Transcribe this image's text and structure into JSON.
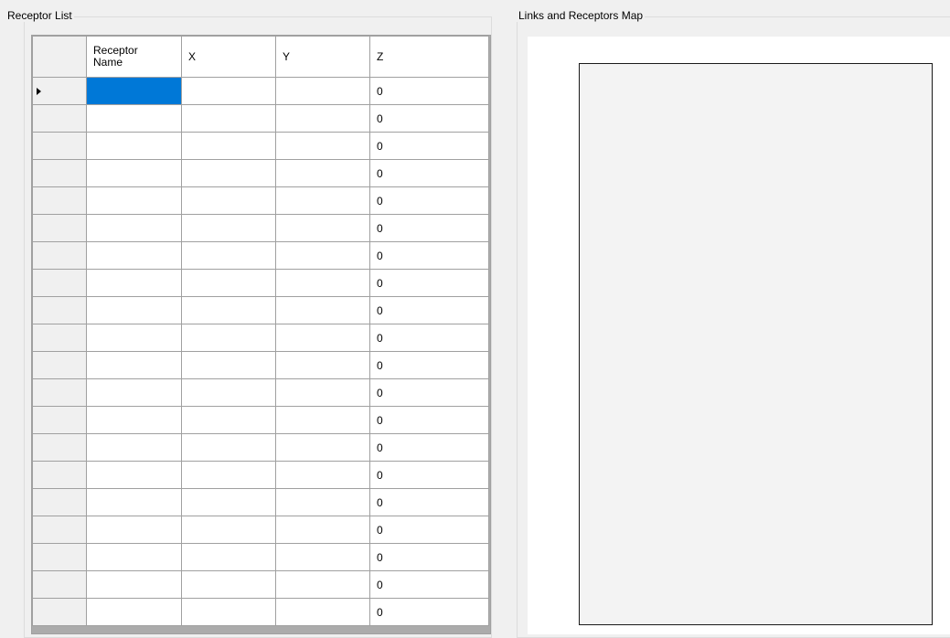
{
  "receptor_list": {
    "title": "Receptor List",
    "columns": [
      "Receptor Name",
      "X",
      "Y",
      "Z"
    ],
    "current_row_indicator": "arrow-right-icon",
    "selected_cell": {
      "row": 0,
      "column": "Receptor Name"
    },
    "rows": [
      {
        "name": "",
        "x": "",
        "y": "",
        "z": "0"
      },
      {
        "name": "",
        "x": "",
        "y": "",
        "z": "0"
      },
      {
        "name": "",
        "x": "",
        "y": "",
        "z": "0"
      },
      {
        "name": "",
        "x": "",
        "y": "",
        "z": "0"
      },
      {
        "name": "",
        "x": "",
        "y": "",
        "z": "0"
      },
      {
        "name": "",
        "x": "",
        "y": "",
        "z": "0"
      },
      {
        "name": "",
        "x": "",
        "y": "",
        "z": "0"
      },
      {
        "name": "",
        "x": "",
        "y": "",
        "z": "0"
      },
      {
        "name": "",
        "x": "",
        "y": "",
        "z": "0"
      },
      {
        "name": "",
        "x": "",
        "y": "",
        "z": "0"
      },
      {
        "name": "",
        "x": "",
        "y": "",
        "z": "0"
      },
      {
        "name": "",
        "x": "",
        "y": "",
        "z": "0"
      },
      {
        "name": "",
        "x": "",
        "y": "",
        "z": "0"
      },
      {
        "name": "",
        "x": "",
        "y": "",
        "z": "0"
      },
      {
        "name": "",
        "x": "",
        "y": "",
        "z": "0"
      },
      {
        "name": "",
        "x": "",
        "y": "",
        "z": "0"
      },
      {
        "name": "",
        "x": "",
        "y": "",
        "z": "0"
      },
      {
        "name": "",
        "x": "",
        "y": "",
        "z": "0"
      },
      {
        "name": "",
        "x": "",
        "y": "",
        "z": "0"
      },
      {
        "name": "",
        "x": "",
        "y": "",
        "z": "0"
      }
    ]
  },
  "map": {
    "title": "Links and Receptors Map"
  },
  "colors": {
    "window_bg": "#f0f0f0",
    "selection": "#0078d7",
    "grid_line": "#a0a0a0",
    "map_area_bg": "#f3f3f3"
  }
}
